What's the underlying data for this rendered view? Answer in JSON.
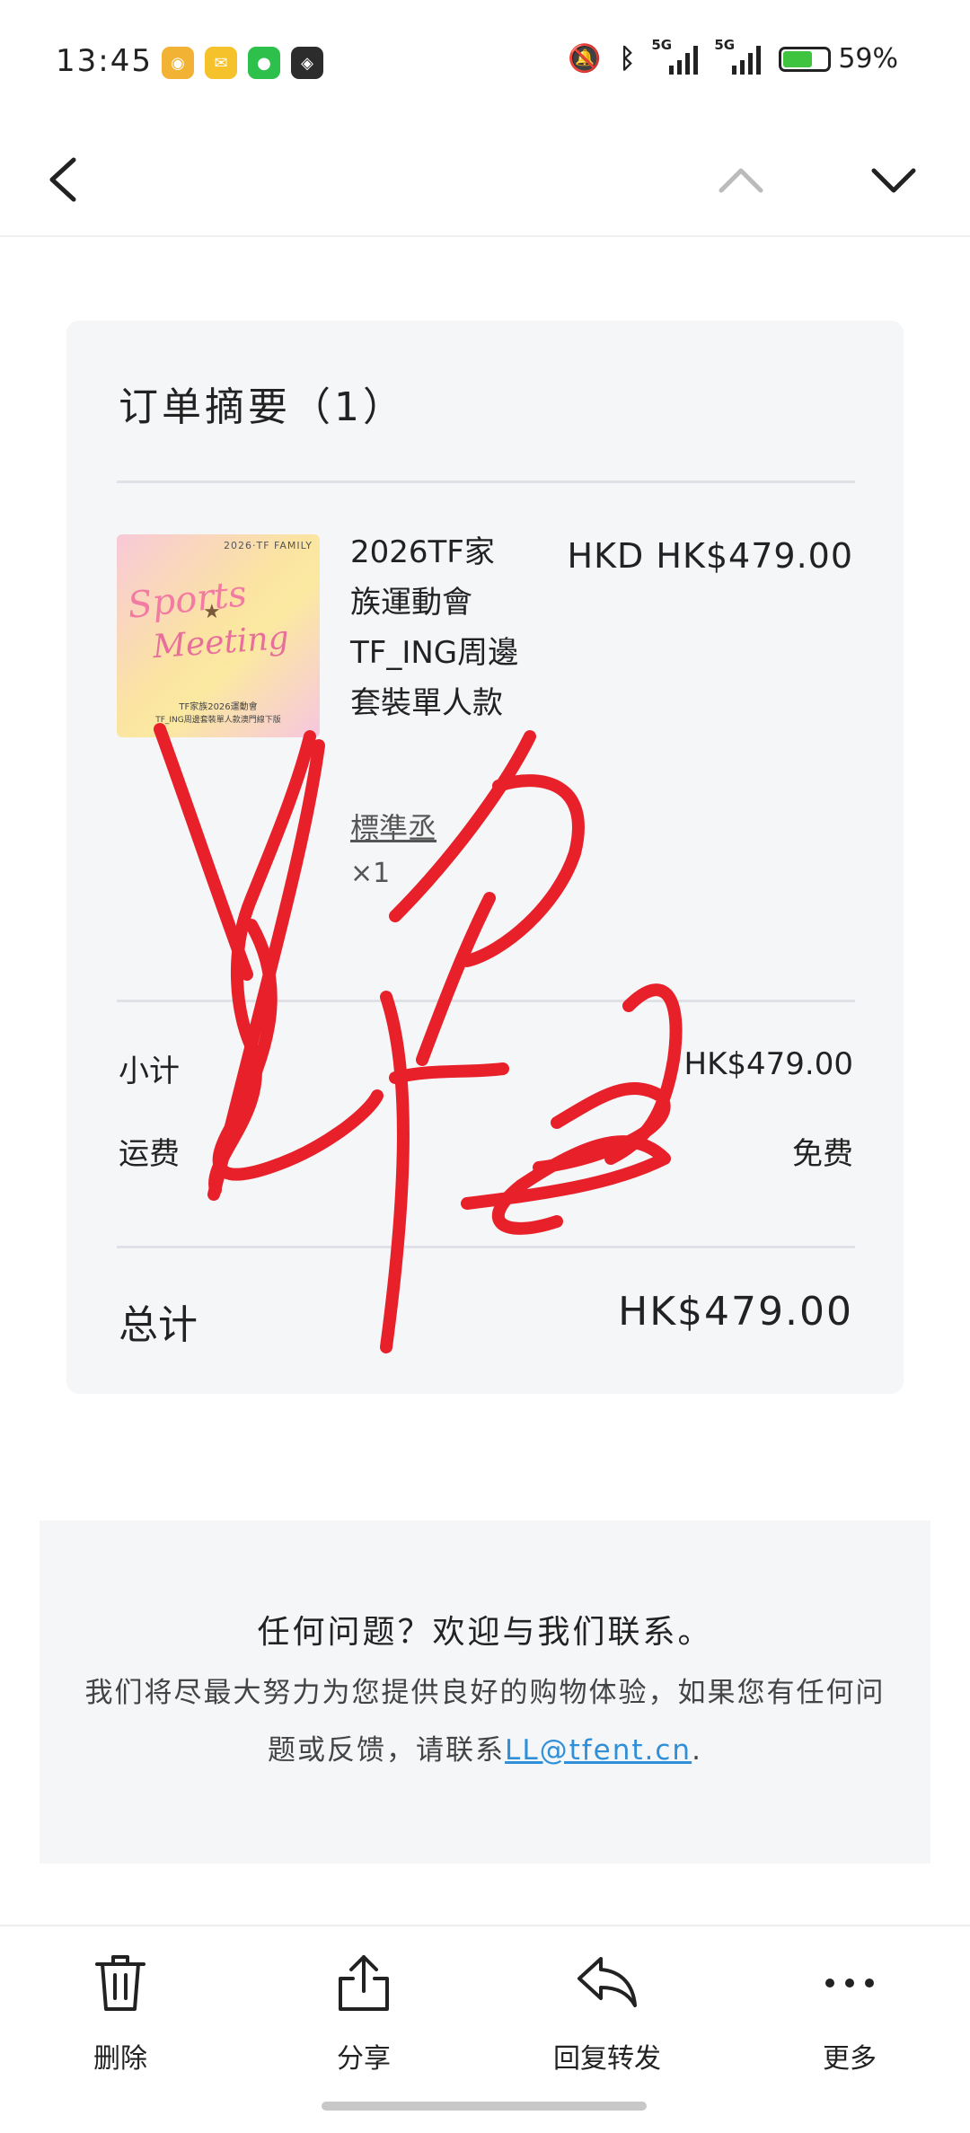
{
  "status_bar": {
    "time": "13:45",
    "notification_icons": [
      "weibo-icon",
      "mail-app-icon",
      "wechat-icon",
      "game-app-icon"
    ],
    "network_1": "5G",
    "network_2": "5G",
    "battery": "59%"
  },
  "nav": {
    "back_icon": "chevron-left-icon",
    "prev_icon": "chevron-up-icon",
    "next_icon": "chevron-down-icon"
  },
  "order": {
    "title": "订单摘要（1）",
    "item": {
      "name": "2026TF家族運動會TF_ING周邊套裝單人款",
      "price": "HKD HK$479.00",
      "variant": "標準丞",
      "qty": "×1",
      "image_text": {
        "brand": "2026·TF FAMILY",
        "title_1": "Sports",
        "title_2": "Meeting",
        "caption_1": "TF家族2026運動會",
        "caption_2": "TF_ING周邊套裝單人款澳門線下版"
      }
    },
    "subtotal_label": "小计",
    "subtotal_value": "HK$479.00",
    "shipping_label": "运费",
    "shipping_value": "免费",
    "total_label": "总计",
    "total_value": "HK$479.00"
  },
  "contact": {
    "title": "任何问题？欢迎与我们联系。",
    "body": "我们将尽最大努力为您提供良好的购物体验，如果您有任何问题或反馈，请联系",
    "email": "LL@tfent.cn",
    "end": "."
  },
  "toolbar": {
    "delete_label": "删除",
    "share_label": "分享",
    "reply_label": "回复转发",
    "more_label": "更多"
  },
  "colors": {
    "scribble": "#e8202a",
    "card_bg": "#f5f6f8",
    "link": "#2f8fd8"
  }
}
